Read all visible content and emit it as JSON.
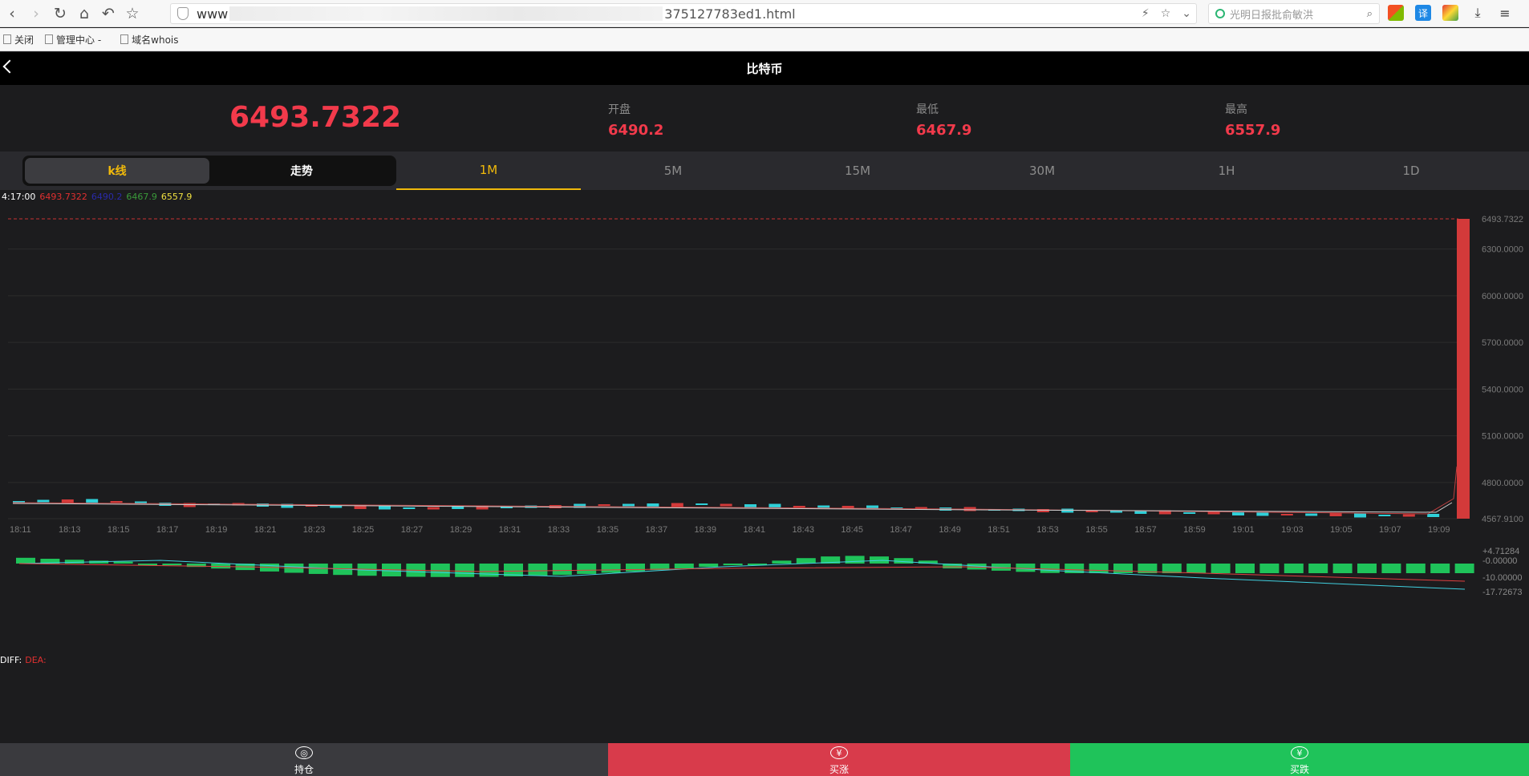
{
  "browser": {
    "url_prefix": "www",
    "url_suffix": "375127783ed1.html",
    "search_placeholder": "光明日报批俞敏洪",
    "ext_translate": "译"
  },
  "bookmarks": [
    "关闭",
    "管理中心 -",
    "域名whois"
  ],
  "header": {
    "title": "比特币"
  },
  "stats": {
    "price": "6493.7322",
    "open_label": "开盘",
    "open": "6490.2",
    "low_label": "最低",
    "low": "6467.9",
    "high_label": "最高",
    "high": "6557.9"
  },
  "tabs": {
    "kline": "k线",
    "trend": "走势",
    "periods": [
      "1M",
      "5M",
      "15M",
      "30M",
      "1H",
      "1D"
    ],
    "active_period": "1M"
  },
  "legend": {
    "time": "4:17:00",
    "v1": "6493.7322",
    "v2": "6490.2",
    "v3": "6467.9",
    "v4": "6557.9"
  },
  "chart_data": {
    "type": "candlestick",
    "price_axis": [
      "6493.7322",
      "6300.0000",
      "6000.0000",
      "5700.0000",
      "5400.0000",
      "5100.0000",
      "4800.0000",
      "4567.9100"
    ],
    "time_axis": [
      "18:11",
      "18:13",
      "18:15",
      "18:17",
      "18:19",
      "18:21",
      "18:23",
      "18:25",
      "18:27",
      "18:29",
      "18:31",
      "18:33",
      "18:35",
      "18:37",
      "18:39",
      "18:41",
      "18:43",
      "18:45",
      "18:47",
      "18:49",
      "18:51",
      "18:53",
      "18:55",
      "18:57",
      "18:59",
      "19:01",
      "19:03",
      "19:05",
      "19:07",
      "19:09"
    ],
    "ylim": [
      4567.91,
      6493.7322
    ],
    "last_price": 6493.7322,
    "colors": {
      "up": "#d33a3a",
      "down": "#2fd0d8",
      "macd_bar": "#1fc35a"
    }
  },
  "macd": {
    "labels": [
      "DIFF:",
      "DEA:"
    ],
    "axis": [
      "+4.71284",
      "-0.00000",
      "-10.00000",
      "-17.72673"
    ]
  },
  "bottom": {
    "hold": "持仓",
    "buy_up": "买涨",
    "buy_down": "买跌"
  }
}
